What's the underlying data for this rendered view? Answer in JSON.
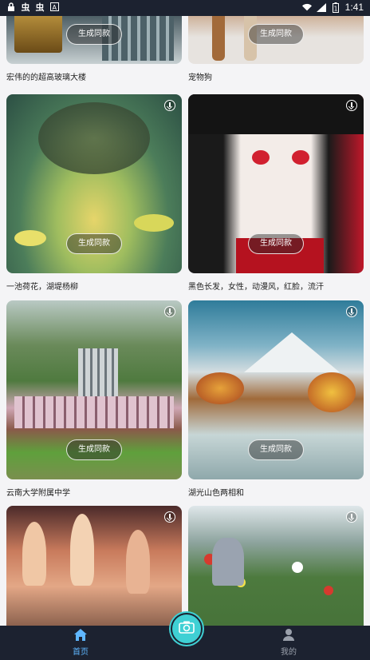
{
  "status": {
    "left_icons": [
      "lock-icon",
      "app-icon",
      "app-icon",
      "font-icon"
    ],
    "time": "1:41",
    "battery": "1"
  },
  "feed": {
    "button_label": "生成同款",
    "cards": [
      {
        "caption": "宏伟的的超高玻璃大楼",
        "has_download": false
      },
      {
        "caption": "宠物狗",
        "has_download": false
      },
      {
        "caption": "一池荷花，湖堤杨柳",
        "has_download": true
      },
      {
        "caption": "黑色长发，女性，动漫风，红脸，流汗",
        "has_download": true
      },
      {
        "caption": "云南大学附属中学",
        "has_download": true
      },
      {
        "caption": "湖光山色两相和",
        "has_download": true
      },
      {
        "caption": "",
        "has_download": true
      },
      {
        "caption": "",
        "has_download": true
      }
    ]
  },
  "nav": {
    "home_label": "首页",
    "mine_label": "我的",
    "accent": "#3fd0d4",
    "active_color": "#5fb7ff",
    "inactive_color": "#9aa0ab"
  }
}
